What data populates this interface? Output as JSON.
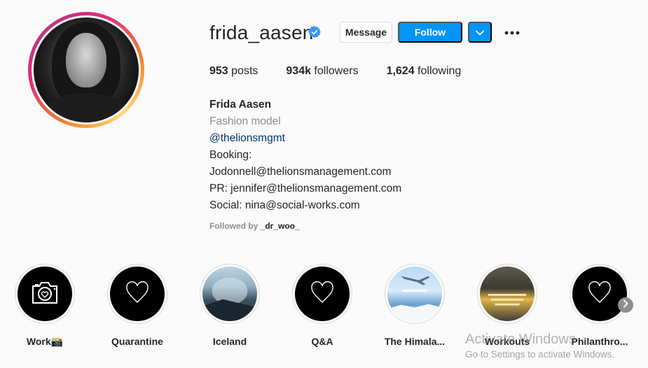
{
  "profile": {
    "username": "frida_aasen",
    "verified": true,
    "buttons": {
      "message": "Message",
      "follow": "Follow"
    },
    "stats": {
      "posts_count": "953",
      "posts_label": " posts",
      "followers_count": "934k",
      "followers_label": " followers",
      "following_count": "1,624",
      "following_label": " following"
    },
    "bio": {
      "full_name": "Frida Aasen",
      "category": "Fashion model",
      "mention": "@thelionsmgmt",
      "lines": [
        "Booking:",
        "Jodonnell@thelionsmanagement.com",
        "PR: jennifer@thelionsmanagement.com",
        "Social: nina@social-works.com"
      ]
    },
    "followed_by": {
      "prefix": "Followed by ",
      "user": "_dr_woo_"
    }
  },
  "highlights": [
    {
      "label": "Work📸",
      "icon": "camera-heart-icon"
    },
    {
      "label": "Quarantine",
      "icon": "heart-icon"
    },
    {
      "label": "Iceland",
      "icon": "airplane-window-photo"
    },
    {
      "label": "Q&A",
      "icon": "heart-icon"
    },
    {
      "label": "The Himala...",
      "icon": "plane-sky-photo"
    },
    {
      "label": "Workouts",
      "icon": "gym-photo"
    },
    {
      "label": "Philanthro...",
      "icon": "heart-icon"
    }
  ],
  "watermark": {
    "title": "Activate Windows",
    "subtitle": "Go to Settings to activate Windows."
  },
  "colors": {
    "accent": "#0095f6",
    "text": "#262626",
    "muted": "#8e8e8e",
    "link": "#00376b",
    "background": "#fafafa"
  }
}
